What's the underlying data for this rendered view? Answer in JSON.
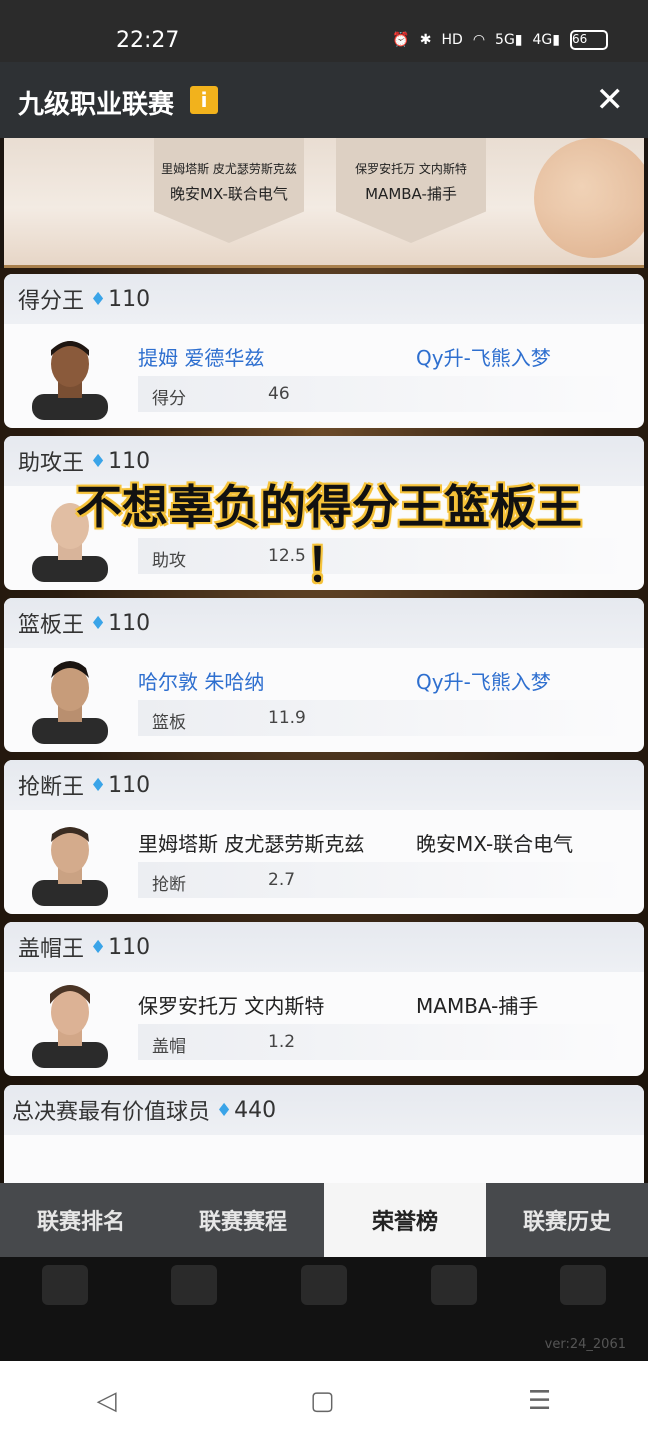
{
  "status_bar": {
    "time": "22:27",
    "icons": [
      "alarm-icon",
      "bluetooth-icon",
      "hd-icon",
      "wifi-icon",
      "5g-signal-icon",
      "4g-signal-icon"
    ],
    "hd": "HD",
    "net5g": "5G",
    "net4g": "4G",
    "battery": "66"
  },
  "header": {
    "title": "九级职业联赛",
    "info_icon": "i",
    "close": "✕"
  },
  "banner": {
    "left": {
      "players": "里姆塔斯 皮尤瑟劳斯克兹",
      "team": "晚安MX-联合电气"
    },
    "right": {
      "players": "保罗安托万 文内斯特",
      "team": "MAMBA-捕手"
    }
  },
  "cards": [
    {
      "title": "得分王",
      "reward": "110",
      "player": "提姆 爱德华兹",
      "team": "Qy升-飞熊入梦",
      "stat_label": "得分",
      "stat_value": "46",
      "highlight": true
    },
    {
      "title": "助攻王",
      "reward": "110",
      "player": "",
      "team": "",
      "stat_label": "助攻",
      "stat_value": "12.5",
      "highlight": false
    },
    {
      "title": "篮板王",
      "reward": "110",
      "player": "哈尔敦 朱哈纳",
      "team": "Qy升-飞熊入梦",
      "stat_label": "篮板",
      "stat_value": "11.9",
      "highlight": true
    },
    {
      "title": "抢断王",
      "reward": "110",
      "player": "里姆塔斯 皮尤瑟劳斯克兹",
      "team": "晚安MX-联合电气",
      "stat_label": "抢断",
      "stat_value": "2.7",
      "highlight": false
    },
    {
      "title": "盖帽王",
      "reward": "110",
      "player": "保罗安托万 文内斯特",
      "team": "MAMBA-捕手",
      "stat_label": "盖帽",
      "stat_value": "1.2",
      "highlight": false
    },
    {
      "title": "总决赛最有价值球员",
      "reward": "440"
    }
  ],
  "overlay_caption": {
    "line1": "不想辜负的得分王篮板王",
    "line2": "！"
  },
  "tabs": [
    "联赛排名",
    "联赛赛程",
    "荣誉榜",
    "联赛历史"
  ],
  "active_tab": "荣誉榜",
  "version": "ver:24_2061",
  "system_nav": {
    "back": "◁",
    "home": "▢",
    "menu": "☰"
  },
  "colors": {
    "accent_gem": "#3aa4e8",
    "highlight_text": "#2e6fcf",
    "info_badge": "#f2b21c"
  }
}
